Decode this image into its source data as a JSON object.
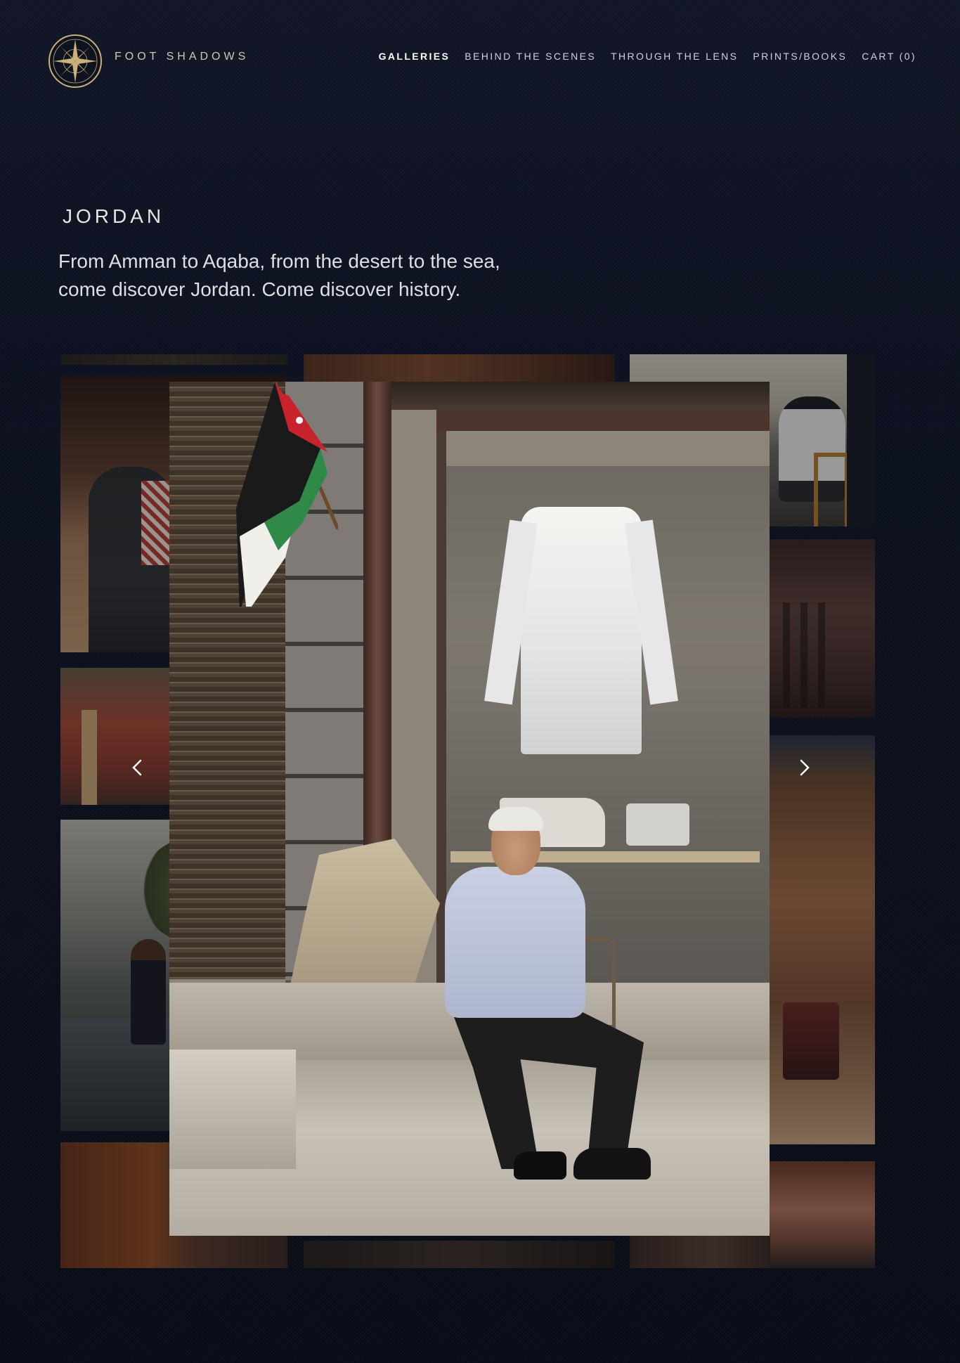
{
  "brand": {
    "name": "FOOT SHADOWS",
    "logo_icon": "compass-rose-icon",
    "accent": "#c9b27a"
  },
  "nav": {
    "items": [
      {
        "label": "GALLERIES",
        "active": true
      },
      {
        "label": "BEHIND THE SCENES",
        "active": false
      },
      {
        "label": "THROUGH THE LENS",
        "active": false
      },
      {
        "label": "PRINTS/BOOKS",
        "active": false
      },
      {
        "label": "CART (0)",
        "active": false
      }
    ]
  },
  "page": {
    "title": "JORDAN",
    "intro_line1": "From Amman to Aqaba, from the desert to the sea,",
    "intro_line2": "come discover Jordan. Come discover history."
  },
  "gallery": {
    "prev_icon": "chevron-left-icon",
    "next_icon": "chevron-right-icon",
    "background": "#0b0e19"
  }
}
